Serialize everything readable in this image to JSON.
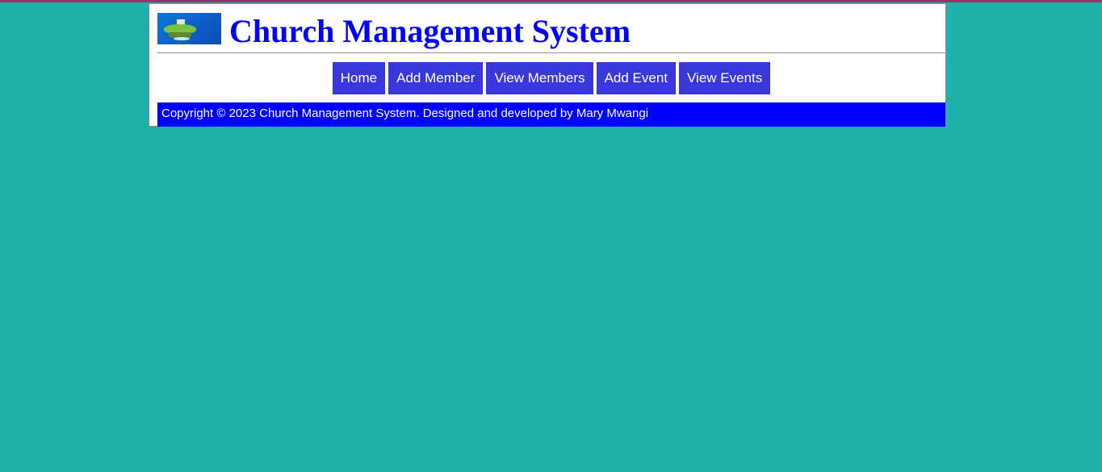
{
  "header": {
    "title": "Church Management System",
    "logo_icon": "island-logo-icon"
  },
  "nav": {
    "items": [
      {
        "label": "Home"
      },
      {
        "label": "Add Member"
      },
      {
        "label": "View Members"
      },
      {
        "label": "Add Event"
      },
      {
        "label": "View Events"
      }
    ]
  },
  "footer": {
    "text": "Copyright © 2023 Church Management System. Designed and developed by Mary Mwangi"
  },
  "colors": {
    "page_background": "#20b2aa",
    "title": "#0000ff",
    "nav_button": "#3737dc",
    "footer_background": "#0000ff",
    "top_bar": "#a0306a"
  }
}
